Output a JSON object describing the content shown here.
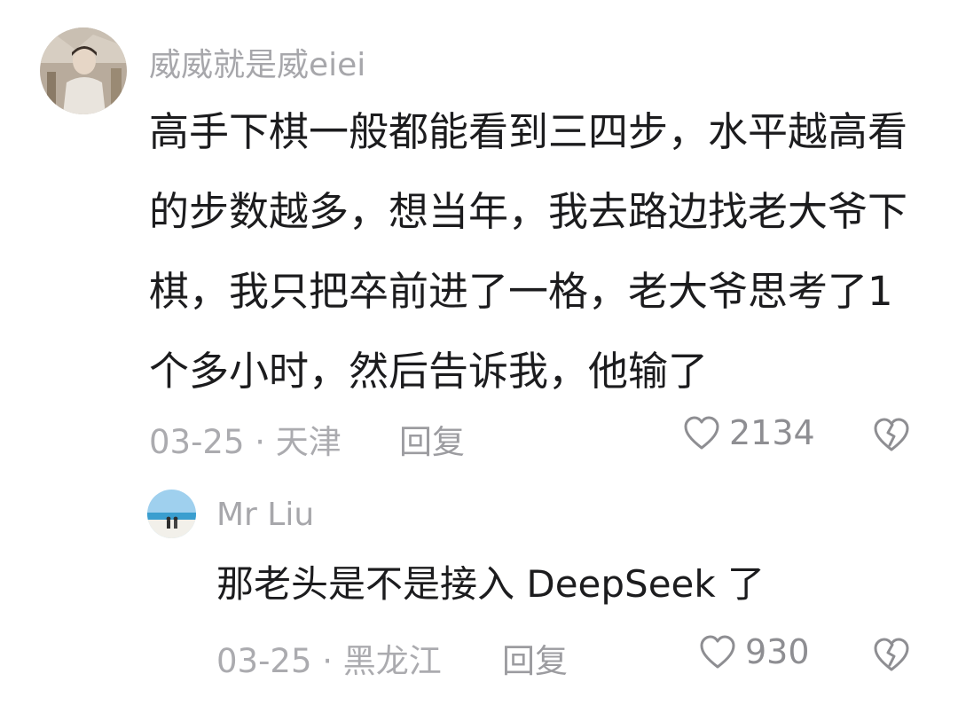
{
  "comments": [
    {
      "username": "威威就是威eiei",
      "avatar_icon": "user-avatar-photo",
      "text": "高手下棋一般都能看到三四步，水平越高看的步数越多，想当年，我去路边找老大爷下棋，我只把卒前进了一格，老大爷思考了1个多小时，然后告诉我，他输了",
      "meta": "03-25 · 天津",
      "reply_label": "回复",
      "likes": "2134",
      "like_icon": "heart-outline-icon",
      "dislike_icon": "broken-heart-icon"
    },
    {
      "username": "Mr Liu",
      "avatar_icon": "beach-avatar-photo",
      "text": "那老头是不是接入 DeepSeek 了",
      "meta": "03-25 · 黑龙江",
      "reply_label": "回复",
      "likes": "930",
      "like_icon": "heart-outline-icon",
      "dislike_icon": "broken-heart-icon"
    }
  ],
  "colors": {
    "text_primary": "#1c1c1e",
    "text_secondary": "#a7a7ab",
    "icon_gray": "#8e8e92"
  }
}
